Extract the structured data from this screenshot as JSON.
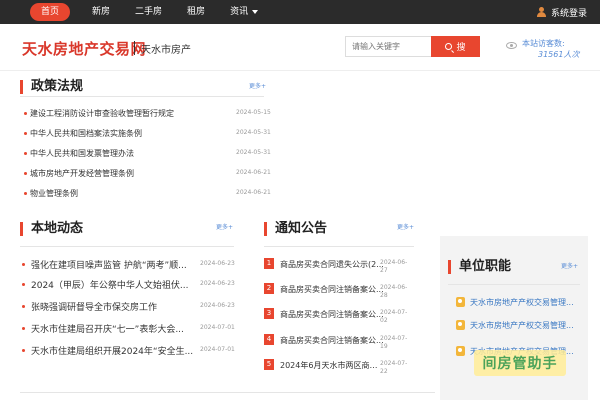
{
  "nav": {
    "items": [
      "首页",
      "新房",
      "二手房",
      "租房",
      "资讯"
    ],
    "login_label": "系统登录"
  },
  "header": {
    "logo": "天水房地产交易网",
    "subtitle": "天水市房产",
    "search_placeholder": "请输入关键字",
    "search_button": "搜",
    "visits_label": "本站访客数:",
    "visits_count": "31561人次"
  },
  "policy": {
    "title": "政策法规",
    "more": "更多+",
    "items": [
      {
        "title": "建设工程消防设计审查验收管理暂行规定",
        "date": "2024-05-15"
      },
      {
        "title": "中华人民共和国档案法实施条例",
        "date": "2024-05-31"
      },
      {
        "title": "中华人民共和国发票管理办法",
        "date": "2024-05-31"
      },
      {
        "title": "城市房地产开发经营管理条例",
        "date": "2024-06-21"
      },
      {
        "title": "物业管理条例",
        "date": "2024-06-21"
      }
    ]
  },
  "local": {
    "title": "本地动态",
    "more": "更多+",
    "items": [
      {
        "title": "强化在建项目噪声监管 护航“两考”顺...",
        "date": "2024-06-23"
      },
      {
        "title": "2024（甲辰）年公祭中华人文始祖伏...",
        "date": "2024-06-23"
      },
      {
        "title": "张晓强调研督导全市保交房工作",
        "date": "2024-06-23"
      },
      {
        "title": "天水市住建局召开庆“七一”表彰大会...",
        "date": "2024-07-01"
      },
      {
        "title": "天水市住建局组织开展2024年“安全生...",
        "date": "2024-07-01"
      }
    ]
  },
  "notice": {
    "title": "通知公告",
    "more": "更多+",
    "items": [
      {
        "num": "1",
        "title": "商品房买卖合同遗失公示(2...",
        "date": "2024-06-27"
      },
      {
        "num": "2",
        "title": "商品房买卖合同注销备案公...",
        "date": "2024-06-28"
      },
      {
        "num": "3",
        "title": "商品房买卖合同注销备案公...",
        "date": "2024-07-02"
      },
      {
        "num": "4",
        "title": "商品房买卖合同注销备案公...",
        "date": "2024-07-19"
      },
      {
        "num": "5",
        "title": "2024年6月天水市两区商品...",
        "date": "2024-07-22"
      }
    ]
  },
  "unit": {
    "title": "单位职能",
    "more": "更多+",
    "items": [
      "天水市房地产产权交易管理...",
      "天水市房地产产权交易管理...",
      "天水市房地产产权交易管理..."
    ]
  },
  "watermark": "间房管助手",
  "colors": {
    "accent": "#e8462f",
    "link": "#5a8dd6",
    "topbar": "#2b2b2b"
  }
}
